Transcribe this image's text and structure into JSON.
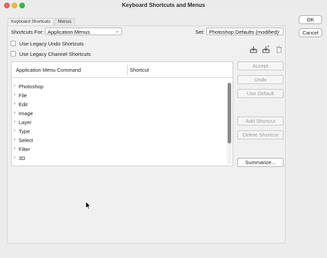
{
  "window": {
    "title": "Keyboard Shortcuts and Menus"
  },
  "tabs": [
    {
      "label": "Keyboard Shortcuts",
      "active": true
    },
    {
      "label": "Menus",
      "active": false
    }
  ],
  "shortcuts_for": {
    "label": "Shortcuts For:",
    "value": "Application Menus"
  },
  "set": {
    "label": "Set:",
    "value": "Photoshop Defaults (modified)"
  },
  "options": {
    "legacy_undo": {
      "label": "Use Legacy Undo Shortcuts",
      "checked": false
    },
    "legacy_channel": {
      "label": "Use Legacy Channel Shortcuts",
      "checked": false
    }
  },
  "table": {
    "columns": [
      "Application Menu Command",
      "Shortcut"
    ],
    "rows": [
      "Photoshop",
      "File",
      "Edit",
      "Image",
      "Layer",
      "Type",
      "Select",
      "Filter",
      "3D"
    ]
  },
  "actions": {
    "accept": "Accept",
    "undo": "Undo",
    "use_default": "Use Default",
    "add_shortcut": "Add Shortcut",
    "delete_shortcut": "Delete Shortcut",
    "summarize": "Summarize..."
  },
  "dialog_buttons": {
    "ok": "OK",
    "cancel": "Cancel"
  },
  "icons": [
    "save-set-icon",
    "save-set-as-icon",
    "delete-set-icon"
  ],
  "colors": {
    "close": "#fe5f57",
    "minimize": "#febc2e",
    "maximize": "#28c840"
  }
}
